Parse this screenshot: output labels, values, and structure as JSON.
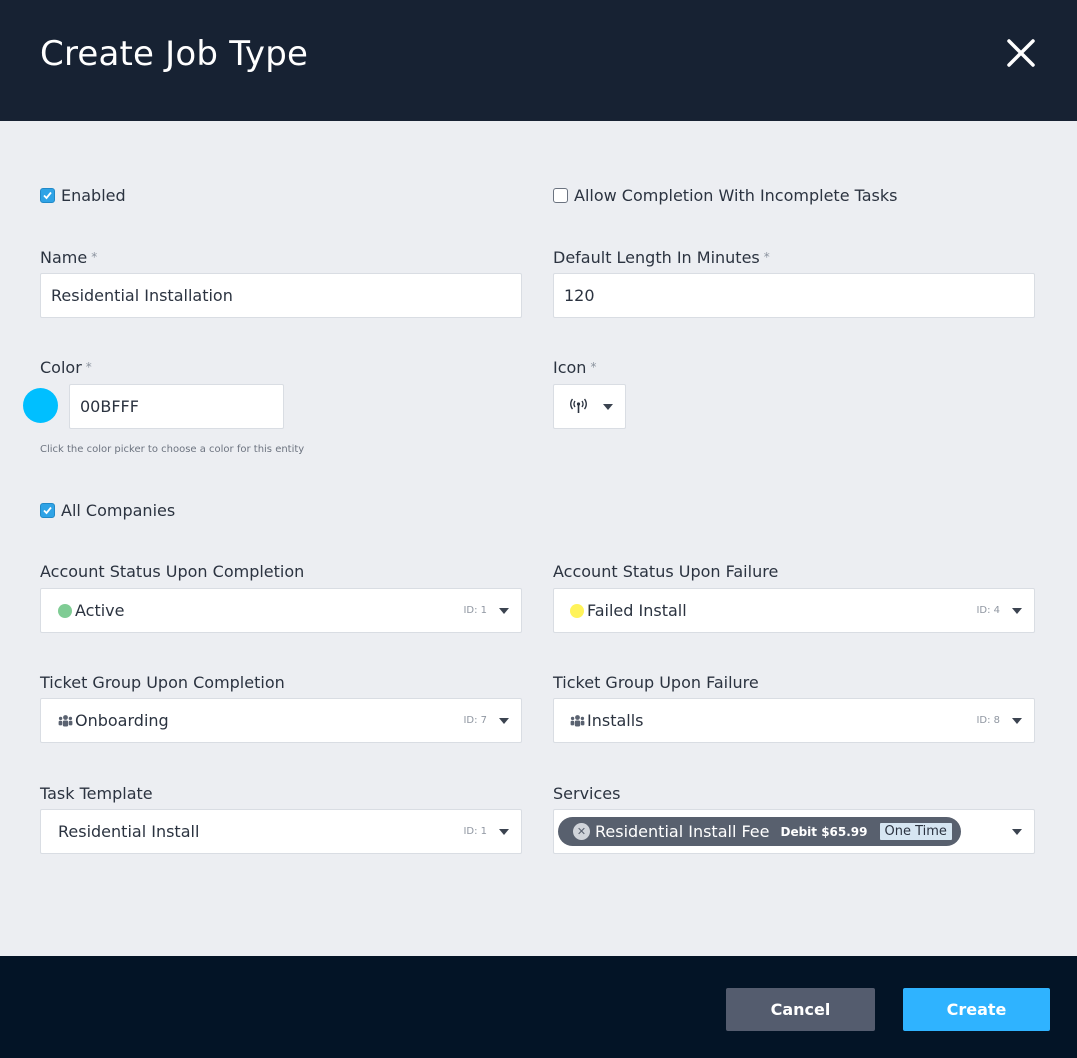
{
  "dialog": {
    "title": "Create Job Type"
  },
  "form": {
    "enabled": {
      "label": "Enabled",
      "checked": true
    },
    "allow_incomplete": {
      "label": "Allow Completion With Incomplete Tasks",
      "checked": false
    },
    "name": {
      "label": "Name",
      "required_mark": "*",
      "value": "Residential Installation"
    },
    "default_length": {
      "label": "Default Length In Minutes",
      "required_mark": "*",
      "value": "120"
    },
    "color": {
      "label": "Color",
      "required_mark": "*",
      "value": "00BFFF",
      "swatch": "#00BFFF",
      "hint": "Click the color picker to choose a color for this entity"
    },
    "icon": {
      "label": "Icon",
      "required_mark": "*",
      "value_icon": "antenna-icon"
    },
    "all_companies": {
      "label": "All Companies",
      "checked": true
    },
    "status_completion": {
      "label": "Account Status Upon Completion",
      "value": "Active",
      "id": "ID: 1",
      "dot_color": "#7fcc94"
    },
    "status_failure": {
      "label": "Account Status Upon Failure",
      "value": "Failed Install",
      "id": "ID: 4",
      "dot_color": "#fff35a"
    },
    "ticket_completion": {
      "label": "Ticket Group Upon Completion",
      "value": "Onboarding",
      "id": "ID: 7",
      "icon": "users-icon"
    },
    "ticket_failure": {
      "label": "Ticket Group Upon Failure",
      "value": "Installs",
      "id": "ID: 8",
      "icon": "users-icon"
    },
    "task_template": {
      "label": "Task Template",
      "value": "Residential Install",
      "id": "ID: 1"
    },
    "services": {
      "label": "Services",
      "chips": [
        {
          "name": "Residential Install Fee",
          "debit": "Debit $65.99",
          "frequency": "One Time"
        }
      ]
    }
  },
  "footer": {
    "cancel_label": "Cancel",
    "create_label": "Create"
  },
  "colors": {
    "header_bg": "#172233",
    "footer_bg": "#031426",
    "primary": "#2fb3ff",
    "secondary_button": "#545c6e",
    "checkbox": "#2fa3e6"
  }
}
